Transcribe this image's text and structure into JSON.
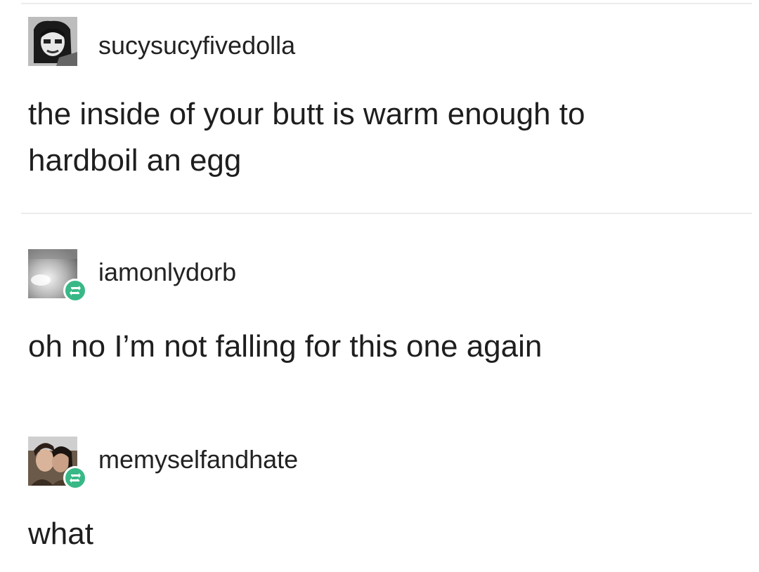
{
  "posts": [
    {
      "username": "sucysucyfivedolla",
      "avatar_icon": "bw-face-avatar-icon",
      "reblogged": false,
      "text_lines": [
        "the inside of your butt is warm enough to",
        "hardboil an egg"
      ]
    },
    {
      "username": "iamonlydorb",
      "avatar_icon": "gray-blur-avatar-icon",
      "reblogged": true,
      "text_lines": [
        "oh no I’m not falling for this one again"
      ]
    },
    {
      "username": "memyselfandhate",
      "avatar_icon": "couple-photo-avatar-icon",
      "reblogged": true,
      "text_lines": [
        "what"
      ]
    }
  ],
  "colors": {
    "reblog_badge": "#39b887",
    "text": "#1e1e1e",
    "divider": "#ececec"
  }
}
